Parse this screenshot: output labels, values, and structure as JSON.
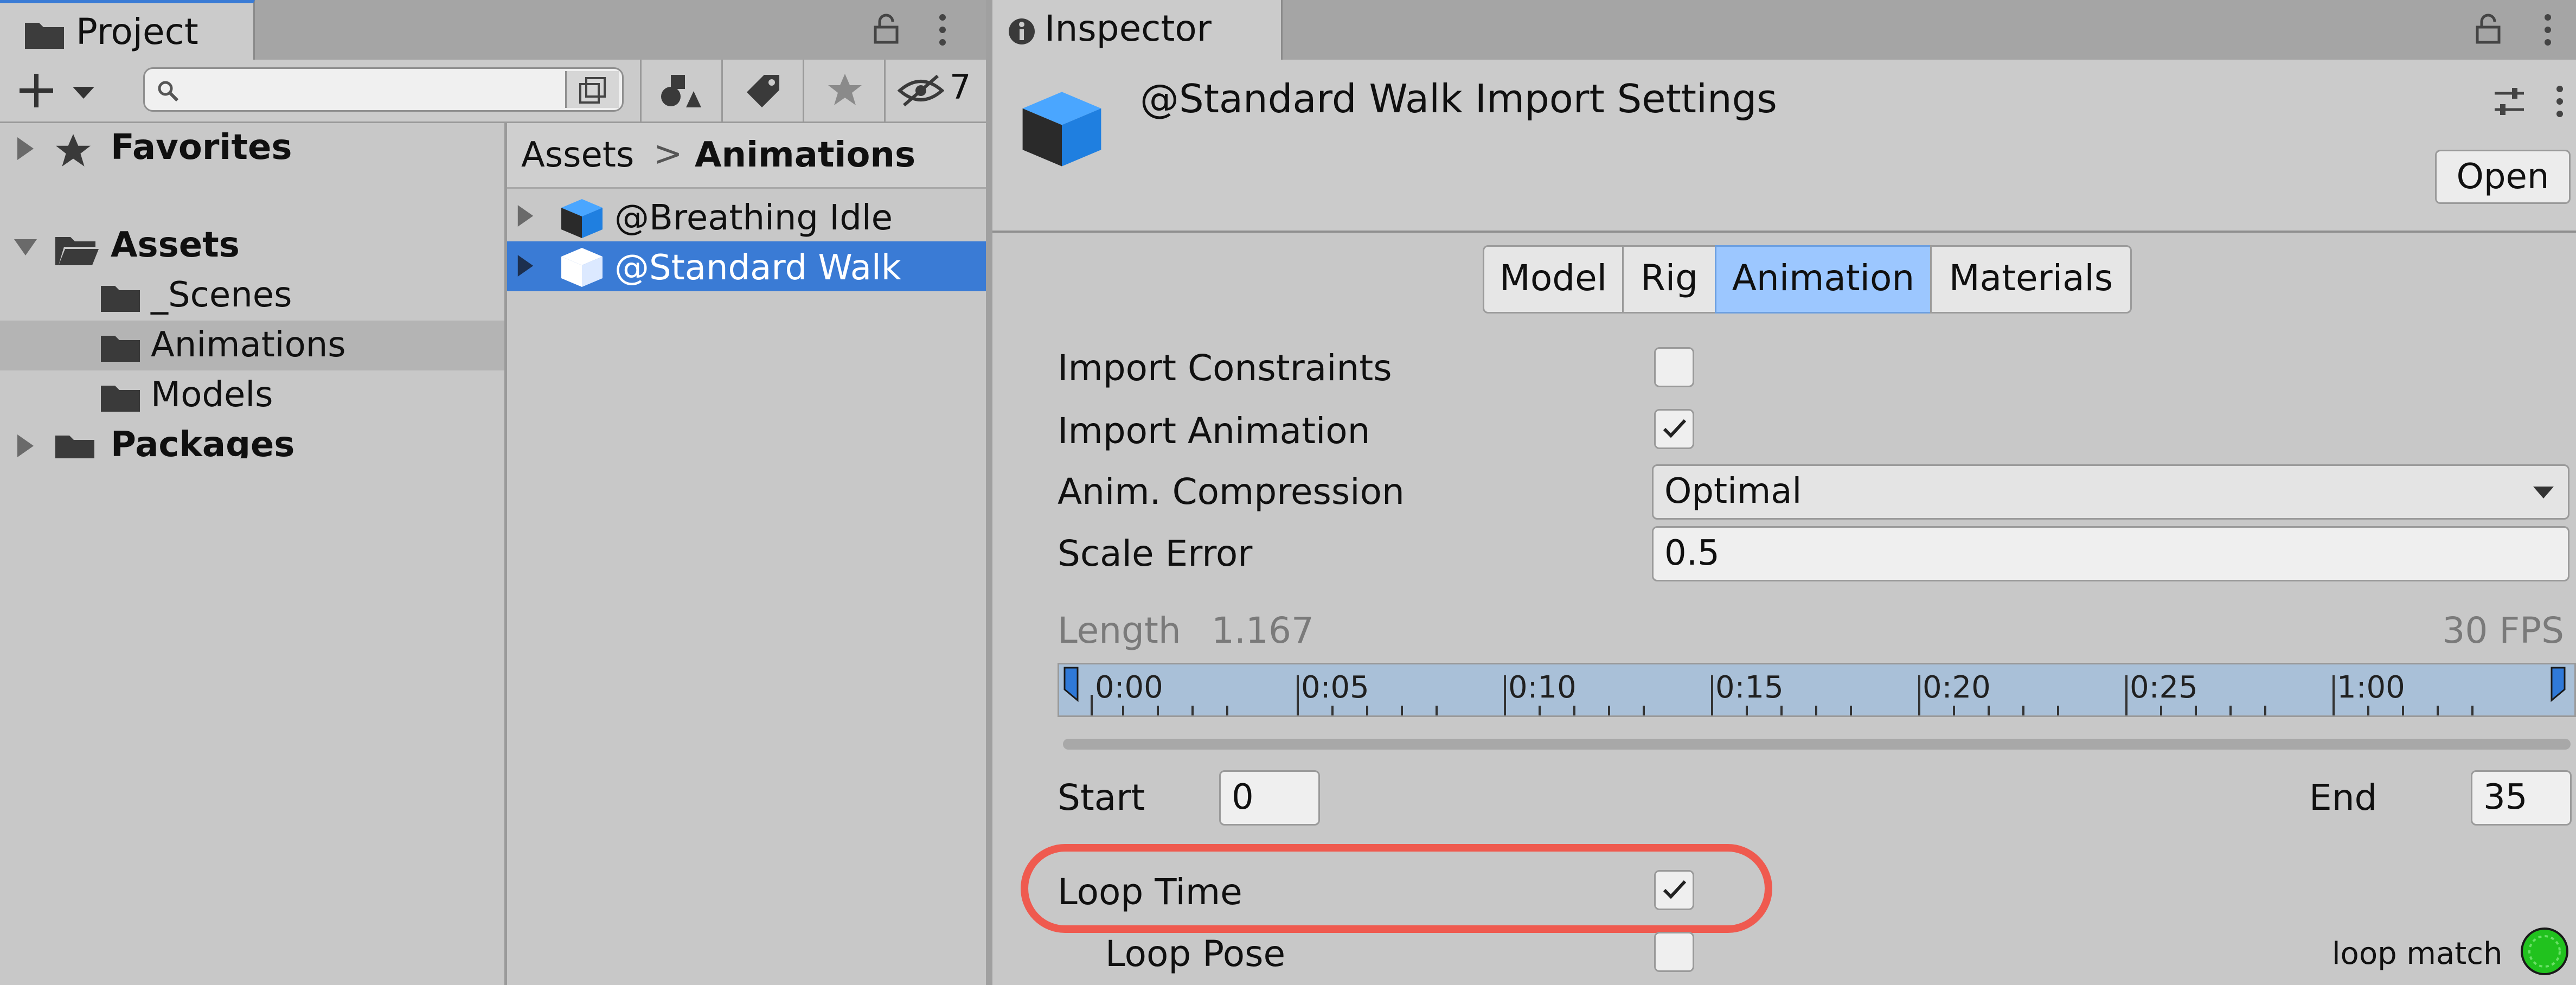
{
  "project": {
    "tab_label": "Project",
    "hidden_count": "7",
    "tree": {
      "favorites": "Favorites",
      "assets": "Assets",
      "scenes": "_Scenes",
      "animations": "Animations",
      "models": "Models",
      "packages": "Packages"
    },
    "breadcrumb": {
      "root": "Assets",
      "separator": ">",
      "current": "Animations"
    },
    "files": [
      "@Breathing Idle",
      "@Standard Walk"
    ]
  },
  "inspector": {
    "tab_label": "Inspector",
    "title": "@Standard Walk Import Settings",
    "open_label": "Open",
    "tabs": [
      "Model",
      "Rig",
      "Animation",
      "Materials"
    ],
    "active_tab": "Animation",
    "props": {
      "import_constraints": {
        "label": "Import Constraints",
        "checked": false
      },
      "import_animation": {
        "label": "Import Animation",
        "checked": true
      },
      "anim_compression": {
        "label": "Anim. Compression",
        "value": "Optimal"
      },
      "scale_error": {
        "label": "Scale Error",
        "value": "0.5"
      }
    },
    "length": {
      "label": "Length",
      "value": "1.167",
      "fps": "30 FPS"
    },
    "timeline_ticks": [
      "0:00",
      "0:05",
      "0:10",
      "0:15",
      "0:20",
      "0:25",
      "1:00"
    ],
    "start": {
      "label": "Start",
      "value": "0"
    },
    "end": {
      "label": "End",
      "value": "35"
    },
    "loop_time": {
      "label": "Loop Time",
      "checked": true
    },
    "loop_pose": {
      "label": "Loop Pose",
      "checked": false
    },
    "loop_match_label": "loop match"
  },
  "colors": {
    "selection": "#3a7bd5",
    "active_tab": "#9cc7ff",
    "highlight_ring": "#ef5a4f",
    "loop_match": "#21c21e"
  }
}
